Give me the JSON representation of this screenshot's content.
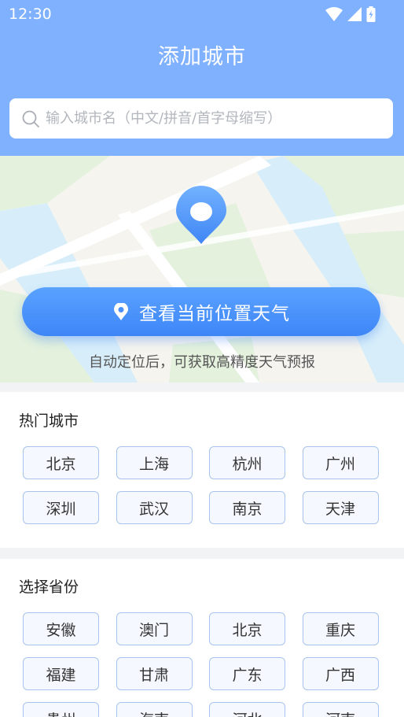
{
  "status": {
    "time": "12:30"
  },
  "header": {
    "title": "添加城市"
  },
  "search": {
    "placeholder": "输入城市名（中文/拼音/首字母缩写）"
  },
  "locate": {
    "button_label": "查看当前位置天气",
    "tip": "自动定位后，可获取高精度天气预报"
  },
  "hot": {
    "title": "热门城市",
    "cities": [
      "北京",
      "上海",
      "杭州",
      "广州",
      "深圳",
      "武汉",
      "南京",
      "天津"
    ]
  },
  "provinces": {
    "title": "选择省份",
    "items": [
      "安徽",
      "澳门",
      "北京",
      "重庆",
      "福建",
      "甘肃",
      "广东",
      "广西",
      "贵州",
      "海南",
      "河北",
      "河南"
    ]
  },
  "colors": {
    "header": "#7fb1ff",
    "accent": "#3e86f7",
    "chip_border": "#a9c4ec"
  }
}
